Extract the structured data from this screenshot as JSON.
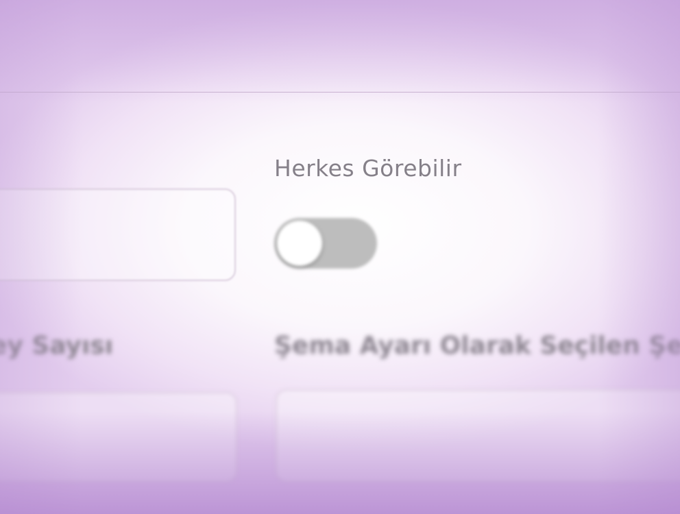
{
  "form": {
    "visibility_label": "Herkes Görebilir",
    "visibility_toggle_on": false,
    "left_field_label": "ey Sayısı",
    "right_field_label": "Şema Ayarı Olarak Seçilen Şe",
    "top_left_input_value": "",
    "bottom_left_input_value": "",
    "bottom_right_input_value": ""
  },
  "colors": {
    "toggle_track": "#bdbdbd",
    "toggle_knob": "#ffffff",
    "label_text": "#858089",
    "accent_vignette": "#b482cd"
  }
}
